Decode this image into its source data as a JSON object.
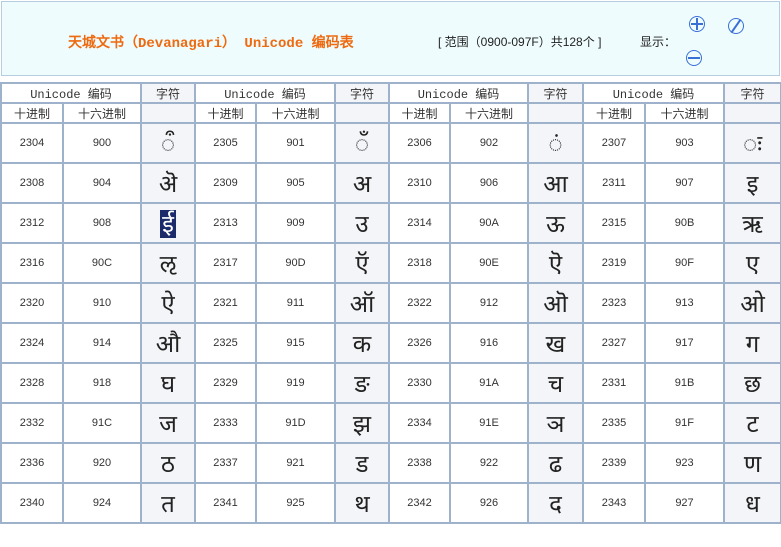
{
  "header": {
    "title": "天城文书（Devanagari） Unicode 编码表",
    "range": "[ 范围（0900-097F）共128个 ]",
    "show_label": "显示："
  },
  "table": {
    "group_header": "Unicode 编码",
    "char_header": "字符",
    "dec_header": "十进制",
    "hex_header": "十六进制",
    "selected_hex": "908",
    "cells": [
      {
        "dec": "2304",
        "hex": "900",
        "ch": "ऀ"
      },
      {
        "dec": "2305",
        "hex": "901",
        "ch": "◌ँ"
      },
      {
        "dec": "2306",
        "hex": "902",
        "ch": "◌ं"
      },
      {
        "dec": "2307",
        "hex": "903",
        "ch": "◌ः"
      },
      {
        "dec": "2308",
        "hex": "904",
        "ch": "ऄ"
      },
      {
        "dec": "2309",
        "hex": "905",
        "ch": "अ"
      },
      {
        "dec": "2310",
        "hex": "906",
        "ch": "आ"
      },
      {
        "dec": "2311",
        "hex": "907",
        "ch": "इ"
      },
      {
        "dec": "2312",
        "hex": "908",
        "ch": "ई"
      },
      {
        "dec": "2313",
        "hex": "909",
        "ch": "उ"
      },
      {
        "dec": "2314",
        "hex": "90A",
        "ch": "ऊ"
      },
      {
        "dec": "2315",
        "hex": "90B",
        "ch": "ऋ"
      },
      {
        "dec": "2316",
        "hex": "90C",
        "ch": "ऌ"
      },
      {
        "dec": "2317",
        "hex": "90D",
        "ch": "ऍ"
      },
      {
        "dec": "2318",
        "hex": "90E",
        "ch": "ऎ"
      },
      {
        "dec": "2319",
        "hex": "90F",
        "ch": "ए"
      },
      {
        "dec": "2320",
        "hex": "910",
        "ch": "ऐ"
      },
      {
        "dec": "2321",
        "hex": "911",
        "ch": "ऑ"
      },
      {
        "dec": "2322",
        "hex": "912",
        "ch": "ऒ"
      },
      {
        "dec": "2323",
        "hex": "913",
        "ch": "ओ"
      },
      {
        "dec": "2324",
        "hex": "914",
        "ch": "औ"
      },
      {
        "dec": "2325",
        "hex": "915",
        "ch": "क"
      },
      {
        "dec": "2326",
        "hex": "916",
        "ch": "ख"
      },
      {
        "dec": "2327",
        "hex": "917",
        "ch": "ग"
      },
      {
        "dec": "2328",
        "hex": "918",
        "ch": "घ"
      },
      {
        "dec": "2329",
        "hex": "919",
        "ch": "ङ"
      },
      {
        "dec": "2330",
        "hex": "91A",
        "ch": "च"
      },
      {
        "dec": "2331",
        "hex": "91B",
        "ch": "छ"
      },
      {
        "dec": "2332",
        "hex": "91C",
        "ch": "ज"
      },
      {
        "dec": "2333",
        "hex": "91D",
        "ch": "झ"
      },
      {
        "dec": "2334",
        "hex": "91E",
        "ch": "ञ"
      },
      {
        "dec": "2335",
        "hex": "91F",
        "ch": "ट"
      },
      {
        "dec": "2336",
        "hex": "920",
        "ch": "ठ"
      },
      {
        "dec": "2337",
        "hex": "921",
        "ch": "ड"
      },
      {
        "dec": "2338",
        "hex": "922",
        "ch": "ढ"
      },
      {
        "dec": "2339",
        "hex": "923",
        "ch": "ण"
      },
      {
        "dec": "2340",
        "hex": "924",
        "ch": "त"
      },
      {
        "dec": "2341",
        "hex": "925",
        "ch": "थ"
      },
      {
        "dec": "2342",
        "hex": "926",
        "ch": "द"
      },
      {
        "dec": "2343",
        "hex": "927",
        "ch": "ध"
      }
    ]
  }
}
